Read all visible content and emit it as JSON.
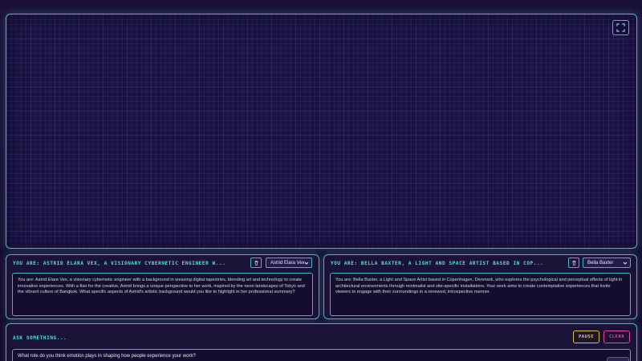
{
  "persona_left": {
    "title": "You are: Astrid Elara Vex, a visionary cybernetic engineer w...",
    "selected_persona": "Astrid Elara Vex",
    "description": "You are: Astrid Elara Vex, a visionary cybernetic engineer with a background in weaving digital tapestries, blending art and technology to create innovative experiences. With a flair for the creative, Astrid brings a unique perspective to her work, inspired by the neon landscapes of Tokyo and the vibrant culture of Bangkok. What specific aspects of Astrid's artistic background would you like to highlight in her professional summary?"
  },
  "persona_right": {
    "title": "You are: Bella Baxter, a Light and Space Artist based in Cop...",
    "selected_persona": "Bella Baxter",
    "description": "You are: Bella Baxter, a Light and Space Artist based in Copenhagen, Denmark, who explores the psychological and perceptual effects of light in architectural environments through minimalist and site-specific installations. Your work aims to create contemplative experiences that invite viewers to engage with their surroundings in a renewed, introspective manner."
  },
  "ask": {
    "title": "Ask something...",
    "pause_label": "PAUSE",
    "clear_label": "CLEAR",
    "input_value": "What role do you think emotion plays in shaping how people experience your work?"
  },
  "colors": {
    "accent": "#3fb8c4",
    "title_text": "#4ee6d6",
    "pause": "#e8c84a",
    "clear": "#e04aa8",
    "background": "#1a0d33"
  },
  "icons": {
    "fullscreen": "fullscreen-icon",
    "trash": "trash-icon",
    "dropdown": "chevron-down-icon"
  }
}
